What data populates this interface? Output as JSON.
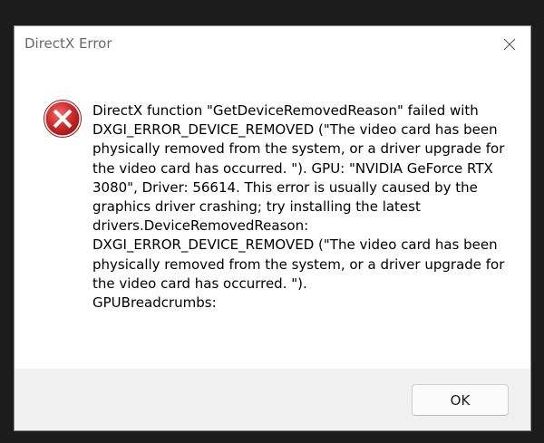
{
  "window": {
    "title": "DirectX Error"
  },
  "message": {
    "text": "DirectX function \"GetDeviceRemovedReason\" failed with\nDXGI_ERROR_DEVICE_REMOVED (\"The video card has been\nphysically removed from the system, or a driver upgrade for\nthe video card has occurred. \"). GPU: \"NVIDIA GeForce RTX\n3080\", Driver: 56614. This error is usually caused by the\ngraphics driver crashing; try installing the latest\ndrivers.DeviceRemovedReason:\nDXGI_ERROR_DEVICE_REMOVED (\"The video card has been\nphysically removed from the system, or a driver upgrade for\nthe video card has occurred. \").\nGPUBreadcrumbs:"
  },
  "buttons": {
    "ok_label": "OK"
  },
  "icons": {
    "error": "error-icon",
    "close": "close-icon"
  },
  "colors": {
    "error_red": "#d32f2f",
    "footer_bg": "#f0f0f0"
  }
}
